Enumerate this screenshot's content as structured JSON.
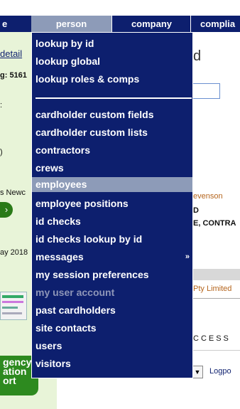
{
  "nav": {
    "left_fragment": "e",
    "tabs": [
      "person",
      "company",
      "complia"
    ]
  },
  "sidebar": {
    "detail": "detail",
    "g_text": "g: 5161",
    "colon_text": ":",
    "paren_text": ")",
    "news_text": "s Newc",
    "circle_text": "›",
    "ay_text": "ay 2018",
    "green_button": "gency\nation\nort"
  },
  "background": {
    "heading_fragment": "d",
    "name_fragment": "evenson",
    "d_fragment": "D",
    "contra_fragment": "E, CONTRA",
    "pty_fragment": "Pty Limited",
    "access_fragment": "CCESS",
    "select_arrow": "▼",
    "logpo_fragment": "Logpo"
  },
  "menu": {
    "group1": [
      {
        "label": "lookup by id"
      },
      {
        "label": "lookup global"
      },
      {
        "label": "lookup roles & comps"
      }
    ],
    "group2": [
      {
        "label": "cardholder custom fields"
      },
      {
        "label": "cardholder custom lists"
      },
      {
        "label": "contractors"
      },
      {
        "label": "crews"
      },
      {
        "label": "employees",
        "state": "highlighted"
      },
      {
        "label": "employee positions"
      },
      {
        "label": "id checks"
      },
      {
        "label": "id checks lookup by id"
      },
      {
        "label": "messages",
        "submenu_arrow": "»"
      },
      {
        "label": "my session preferences"
      },
      {
        "label": "my user account",
        "state": "disabled"
      },
      {
        "label": "past cardholders"
      },
      {
        "label": "site contacts"
      },
      {
        "label": "users"
      },
      {
        "label": "visitors"
      }
    ]
  },
  "colors": {
    "nav_bg": "#0d1f6e",
    "menu_bg": "#0d1f6e",
    "highlight": "#8d9bb8",
    "sidebar_bg": "#e8f4d8",
    "green": "#2d8a1f",
    "link_orange": "#b5651d"
  }
}
